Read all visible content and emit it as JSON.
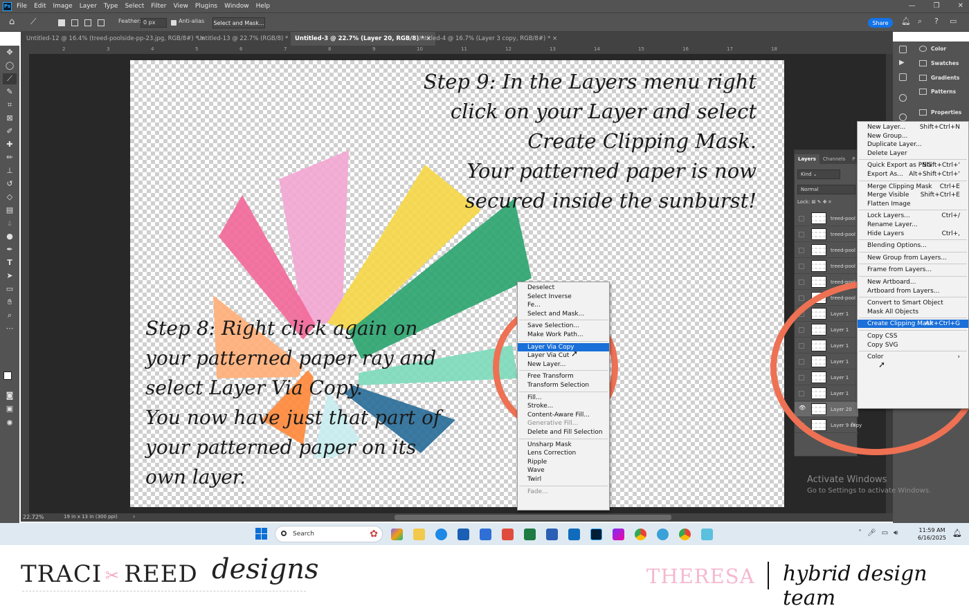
{
  "menubar": {
    "app_icon": "Ps",
    "items": [
      "File",
      "Edit",
      "Image",
      "Layer",
      "Type",
      "Select",
      "Filter",
      "View",
      "Plugins",
      "Window",
      "Help"
    ]
  },
  "options": {
    "feather_label": "Feather:",
    "feather_value": "0 px",
    "antialias_label": "Anti-alias",
    "select_mask": "Select and Mask...",
    "share": "Share"
  },
  "tabs": [
    {
      "label": "Untitled-12 @ 16.4% (treed-poolside-pp-23.jpg, RGB/8#) *"
    },
    {
      "label": "Untitled-13 @ 22.7% (RGB/8) *"
    },
    {
      "label": "Untitled-3 @ 22.7% (Layer 20, RGB/8) *"
    },
    {
      "label": "Untitled-4 @ 16.7% (Layer 3 copy, RGB/8#) *"
    }
  ],
  "tab_close": "×",
  "ruler_ticks": [
    "2",
    "3",
    "4",
    "5",
    "6",
    "7",
    "8",
    "9",
    "10",
    "11",
    "12",
    "13",
    "14",
    "15",
    "16",
    "17",
    "18"
  ],
  "canvas": {
    "step9": [
      "Step 9: In the Layers menu right",
      "click on your Layer and select",
      "Create Clipping Mask.",
      "Your patterned paper is now",
      "secured inside the sunburst!"
    ],
    "step8": [
      "Step 8: Right click again on",
      "your patterned paper ray and",
      "select Layer Via Copy.",
      "You now have just that part of",
      "your patterned paper on its",
      "own layer."
    ]
  },
  "status": {
    "zoom": "22.72%",
    "docsize": "19 in x 13 in (300 ppi)"
  },
  "right_panel": [
    "Color",
    "Swatches",
    "Gradients",
    "Patterns",
    "Properties"
  ],
  "layers_panel": {
    "tabs": [
      "Layers",
      "Channels",
      "P"
    ],
    "kind": "Kind",
    "blend": "Normal",
    "lock": "Lock:",
    "rows": [
      "treed-pool",
      "treed-pool",
      "treed-pool",
      "treed-pool",
      "treed-pool",
      "treed-pool",
      "Layer 1",
      "Layer 1",
      "Layer 1",
      "Layer 1",
      "Layer 1",
      "Layer 1",
      "Layer 20",
      "Layer 9 copy"
    ],
    "fx": "fx"
  },
  "context_menu_1": {
    "items": [
      {
        "label": "Deselect"
      },
      {
        "label": "Select Inverse"
      },
      {
        "label": "Fe..."
      },
      {
        "label": "Select and Mask..."
      },
      {
        "label": "Save Selection..."
      },
      {
        "label": "Make Work Path..."
      },
      {
        "label": "Layer Via Copy",
        "highlight": true
      },
      {
        "label": "Layer Via Cut"
      },
      {
        "label": "New Layer..."
      },
      {
        "label": "Free Transform"
      },
      {
        "label": "Transform Selection"
      },
      {
        "label": "Fill..."
      },
      {
        "label": "Stroke..."
      },
      {
        "label": "Content-Aware Fill..."
      },
      {
        "label": "Generative Fill...",
        "disabled": true
      },
      {
        "label": "Delete and Fill Selection"
      },
      {
        "label": "Unsharp Mask"
      },
      {
        "label": "Lens Correction"
      },
      {
        "label": "Ripple"
      },
      {
        "label": "Wave"
      },
      {
        "label": "Twirl"
      },
      {
        "label": "Fade...",
        "disabled": true
      }
    ]
  },
  "context_menu_2": {
    "items": [
      {
        "label": "New Layer...",
        "shortcut": "Shift+Ctrl+N"
      },
      {
        "label": "New Group..."
      },
      {
        "label": "Duplicate Layer..."
      },
      {
        "label": "Delete Layer"
      },
      {
        "label": "Quick Export as PNG",
        "shortcut": "Shift+Ctrl+'"
      },
      {
        "label": "Export As...",
        "shortcut": "Alt+Shift+Ctrl+'"
      },
      {
        "label": "Merge Clipping Mask",
        "shortcut": "Ctrl+E"
      },
      {
        "label": "Merge Visible",
        "shortcut": "Shift+Ctrl+E"
      },
      {
        "label": "Flatten Image"
      },
      {
        "label": "Lock Layers...",
        "shortcut": "Ctrl+/"
      },
      {
        "label": "Rename Layer..."
      },
      {
        "label": "Hide Layers",
        "shortcut": "Ctrl+,"
      },
      {
        "label": "Blending Options..."
      },
      {
        "label": "New Group from Layers..."
      },
      {
        "label": "Frame from Layers..."
      },
      {
        "label": "New Artboard..."
      },
      {
        "label": "Artboard from Layers..."
      },
      {
        "label": "Convert to Smart Object"
      },
      {
        "label": "Mask All Objects"
      },
      {
        "label": "Create Clipping Mask",
        "shortcut": "Alt+Ctrl+G",
        "highlight": true
      },
      {
        "label": "Copy CSS"
      },
      {
        "label": "Copy SVG"
      },
      {
        "label": "Color",
        "shortcut": "›"
      }
    ]
  },
  "activate_windows": {
    "title": "Activate Windows",
    "subtitle": "Go to Settings to activate Windows."
  },
  "taskbar": {
    "search": "Search",
    "time": "11:59 AM",
    "date": "6/16/2025"
  },
  "footer": {
    "logo_left": "TRACI",
    "logo_right": "REED",
    "logo_script": "designs",
    "name": "THERESA",
    "team": "hybrid design team"
  },
  "colors": {
    "accent_ring": "#ee7154",
    "highlight": "#1a6fd8",
    "ps_bg": "#535353"
  },
  "rays": [
    {
      "color": "#f3a8d4",
      "label": "pink-light"
    },
    {
      "color": "#f6d84a",
      "label": "yellow"
    },
    {
      "color": "#2fa571",
      "label": "green"
    },
    {
      "color": "#7fdbbc",
      "label": "mint"
    },
    {
      "color": "#2c6f9a",
      "label": "navy"
    },
    {
      "color": "#c9eef0",
      "label": "aqua"
    },
    {
      "color": "#ff8a3d",
      "label": "orange"
    },
    {
      "color": "#ffb07a",
      "label": "peach"
    },
    {
      "color": "#f26a9a",
      "label": "hot-pink"
    }
  ]
}
